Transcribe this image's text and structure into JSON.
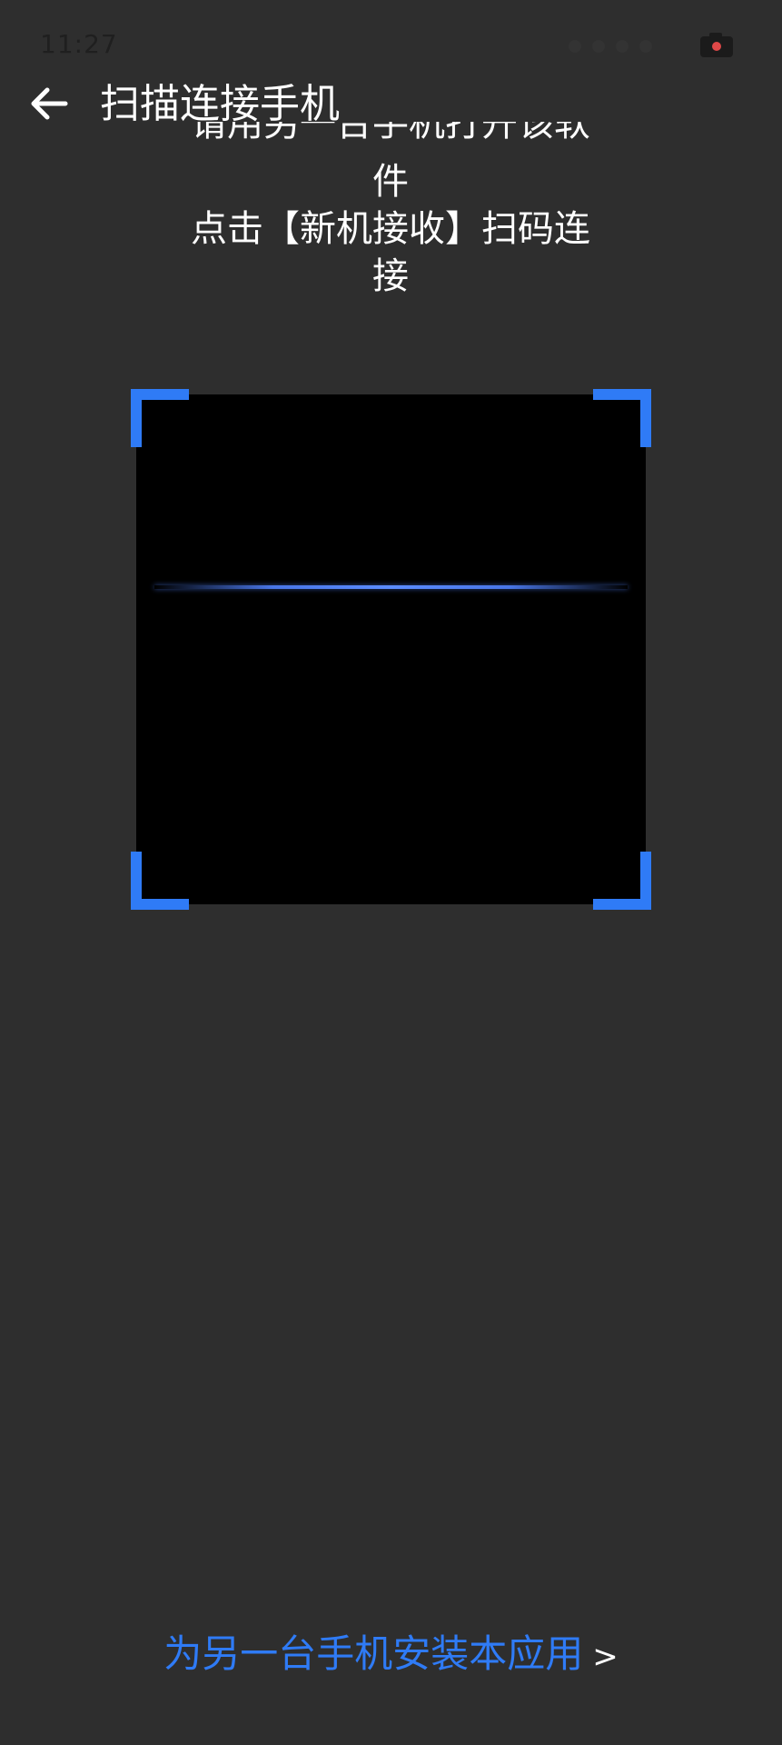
{
  "status_bar": {
    "time": "11:27",
    "camera_icon": "camera-recording-icon"
  },
  "app_bar": {
    "back_icon": "arrow-left-icon",
    "title": "扫描连接手机"
  },
  "instructions": {
    "line1_partial": "请用另一台手机打开该软",
    "line2": "件",
    "line3": "点击【新机接收】扫码连",
    "line4": "接"
  },
  "scanner": {
    "accent_color": "#2f7bf6",
    "scan_line_color": "#5b8cff"
  },
  "footer": {
    "install_link_label": "为另一台手机安装本应用",
    "chevron": ">"
  }
}
